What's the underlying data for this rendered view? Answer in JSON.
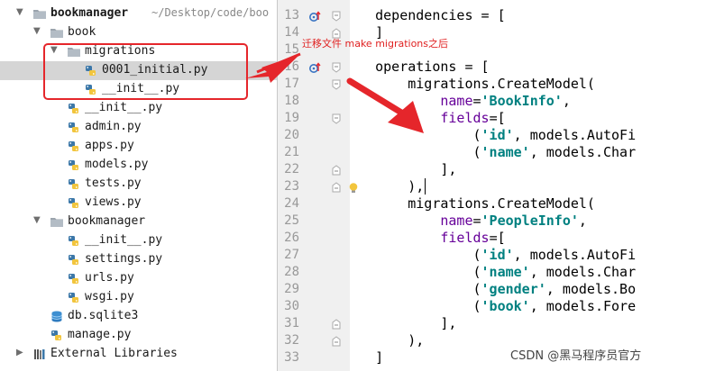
{
  "project_tree": {
    "items": [
      {
        "label": "bookmanager",
        "path": "~/Desktop/code/boo",
        "icon": "folder-icon",
        "expanded": true,
        "indent": 0,
        "bold": true
      },
      {
        "label": "book",
        "icon": "folder-icon",
        "expanded": true,
        "indent": 1
      },
      {
        "label": "migrations",
        "icon": "folder-icon",
        "expanded": true,
        "indent": 2
      },
      {
        "label": "0001_initial.py",
        "icon": "python-file-icon",
        "indent": 3,
        "selected": true
      },
      {
        "label": "__init__.py",
        "icon": "python-file-icon",
        "indent": 3
      },
      {
        "label": "__init__.py",
        "icon": "python-file-icon",
        "indent": 2
      },
      {
        "label": "admin.py",
        "icon": "python-file-icon",
        "indent": 2
      },
      {
        "label": "apps.py",
        "icon": "python-file-icon",
        "indent": 2
      },
      {
        "label": "models.py",
        "icon": "python-file-icon",
        "indent": 2
      },
      {
        "label": "tests.py",
        "icon": "python-file-icon",
        "indent": 2
      },
      {
        "label": "views.py",
        "icon": "python-file-icon",
        "indent": 2
      },
      {
        "label": "bookmanager",
        "icon": "folder-icon",
        "expanded": true,
        "indent": 1
      },
      {
        "label": "__init__.py",
        "icon": "python-file-icon",
        "indent": 2
      },
      {
        "label": "settings.py",
        "icon": "python-file-icon",
        "indent": 2
      },
      {
        "label": "urls.py",
        "icon": "python-file-icon",
        "indent": 2
      },
      {
        "label": "wsgi.py",
        "icon": "python-file-icon",
        "indent": 2
      },
      {
        "label": "db.sqlite3",
        "icon": "database-icon",
        "indent": 1
      },
      {
        "label": "manage.py",
        "icon": "python-file-icon",
        "indent": 1
      },
      {
        "label": "External Libraries",
        "icon": "libraries-icon",
        "expanded": false,
        "indent": 0
      }
    ]
  },
  "annotation": {
    "text": "迁移文件 make migrations之后",
    "color": "#e5262b"
  },
  "editor": {
    "line_numbers": [
      "13",
      "14",
      "15",
      "16",
      "17",
      "18",
      "19",
      "20",
      "21",
      "22",
      "23",
      "24",
      "25",
      "26",
      "27",
      "28",
      "29",
      "30",
      "31",
      "32",
      "33"
    ],
    "current_line": "23",
    "lines": [
      [
        {
          "t": "    dependencies = [",
          "c": "pl"
        }
      ],
      [
        {
          "t": "    ]",
          "c": "pl"
        }
      ],
      [
        {
          "t": "",
          "c": "pl"
        }
      ],
      [
        {
          "t": "    operations = [",
          "c": "pl"
        }
      ],
      [
        {
          "t": "        migrations.CreateModel(",
          "c": "pl"
        }
      ],
      [
        {
          "t": "            ",
          "c": "pl"
        },
        {
          "t": "name",
          "c": "kw"
        },
        {
          "t": "=",
          "c": "pl"
        },
        {
          "t": "'BookInfo'",
          "c": "str"
        },
        {
          "t": ",",
          "c": "pl"
        }
      ],
      [
        {
          "t": "            ",
          "c": "pl"
        },
        {
          "t": "fields",
          "c": "kw"
        },
        {
          "t": "=[",
          "c": "pl"
        }
      ],
      [
        {
          "t": "                (",
          "c": "pl"
        },
        {
          "t": "'id'",
          "c": "str"
        },
        {
          "t": ", models.AutoFi",
          "c": "pl"
        }
      ],
      [
        {
          "t": "                (",
          "c": "pl"
        },
        {
          "t": "'name'",
          "c": "str"
        },
        {
          "t": ", models.Char",
          "c": "pl"
        }
      ],
      [
        {
          "t": "            ],",
          "c": "pl"
        }
      ],
      [
        {
          "t": "        ),",
          "c": "pl"
        }
      ],
      [
        {
          "t": "        migrations.CreateModel(",
          "c": "pl"
        }
      ],
      [
        {
          "t": "            ",
          "c": "pl"
        },
        {
          "t": "name",
          "c": "kw"
        },
        {
          "t": "=",
          "c": "pl"
        },
        {
          "t": "'PeopleInfo'",
          "c": "str"
        },
        {
          "t": ",",
          "c": "pl"
        }
      ],
      [
        {
          "t": "            ",
          "c": "pl"
        },
        {
          "t": "fields",
          "c": "kw"
        },
        {
          "t": "=[",
          "c": "pl"
        }
      ],
      [
        {
          "t": "                (",
          "c": "pl"
        },
        {
          "t": "'id'",
          "c": "str"
        },
        {
          "t": ", models.AutoFi",
          "c": "pl"
        }
      ],
      [
        {
          "t": "                (",
          "c": "pl"
        },
        {
          "t": "'name'",
          "c": "str"
        },
        {
          "t": ", models.Char",
          "c": "pl"
        }
      ],
      [
        {
          "t": "                (",
          "c": "pl"
        },
        {
          "t": "'gender'",
          "c": "str"
        },
        {
          "t": ", models.Bo",
          "c": "pl"
        }
      ],
      [
        {
          "t": "                (",
          "c": "pl"
        },
        {
          "t": "'book'",
          "c": "str"
        },
        {
          "t": ", models.Fore",
          "c": "pl"
        }
      ],
      [
        {
          "t": "            ],",
          "c": "pl"
        }
      ],
      [
        {
          "t": "        ),",
          "c": "pl"
        }
      ],
      [
        {
          "t": "    ]",
          "c": "pl"
        }
      ]
    ]
  },
  "watermark": "CSDN @黑马程序员官方"
}
